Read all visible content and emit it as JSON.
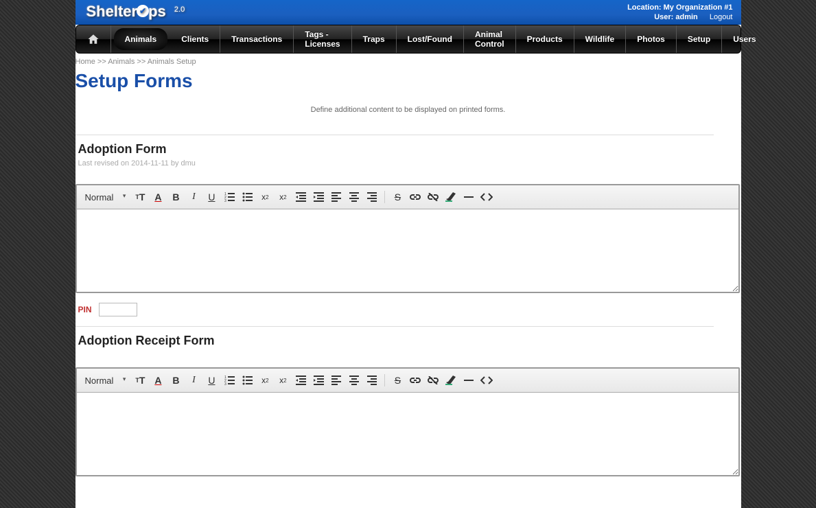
{
  "header": {
    "logo_pre": "Shelter",
    "logo_post": "ps",
    "version": "2.0",
    "location_label": "Location:",
    "location_value": "My Organization #1",
    "user_label": "User:",
    "user_value": "admin",
    "logout": "Logout"
  },
  "nav": {
    "items": [
      "Animals",
      "Clients",
      "Transactions",
      "Tags - Licenses",
      "Traps",
      "Lost/Found",
      "Animal Control",
      "Products",
      "Wildlife",
      "Photos",
      "Setup",
      "Users"
    ],
    "active_index": 0
  },
  "breadcrumbs": {
    "home": "Home",
    "sep": ">>",
    "animals": "Animals",
    "setup": "Animals Setup"
  },
  "page": {
    "title": "Setup Forms",
    "description": "Define additional content to be displayed on printed forms."
  },
  "sections": {
    "adoption": {
      "title": "Adoption Form",
      "revised": "Last revised on 2014-11-11 by dmu"
    },
    "receipt": {
      "title": "Adoption Receipt Form"
    }
  },
  "editor": {
    "format": "Normal",
    "icons": [
      "font-size",
      "text-color",
      "bold",
      "italic",
      "underline",
      "ordered-list",
      "unordered-list",
      "subscript",
      "superscript",
      "outdent",
      "indent",
      "align-left",
      "align-center",
      "align-right",
      "strikethrough",
      "link",
      "unlink",
      "remove-format",
      "horizontal-rule",
      "code-view"
    ]
  },
  "pin": {
    "label": "PIN",
    "value": ""
  }
}
